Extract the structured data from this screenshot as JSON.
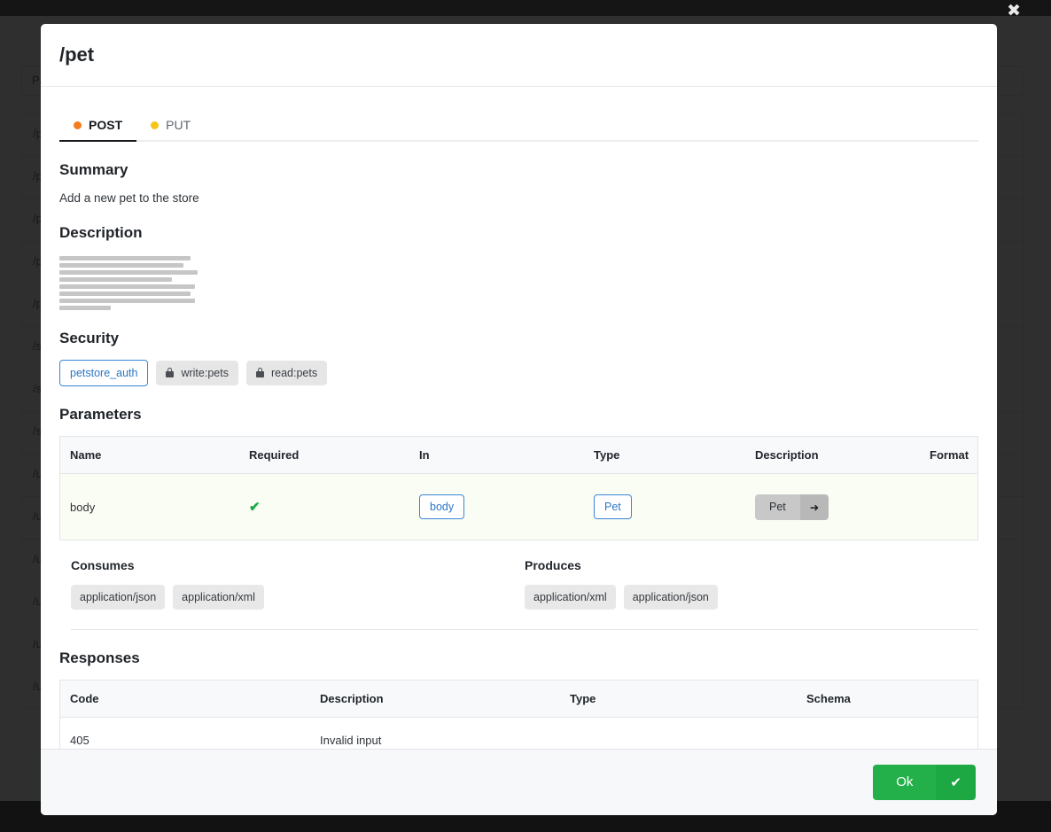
{
  "background": {
    "search_value": "Pa",
    "rows": [
      {
        "label": "/pet"
      },
      {
        "label": "/pet/findByStatus"
      },
      {
        "label": "/pet/findByTags"
      },
      {
        "label": "/pet/{petId}"
      },
      {
        "label": "/pet/{petId}/uploadImage"
      },
      {
        "label": "/store/inventory"
      },
      {
        "label": "/store/order"
      },
      {
        "label": "/store/order/{orderId}"
      },
      {
        "label": "/user"
      },
      {
        "label": "/user/createWithArray"
      },
      {
        "label": "/user/createWithList"
      },
      {
        "label": "/user/login"
      },
      {
        "label": "/user/logout"
      },
      {
        "label": "/user/{username}"
      }
    ]
  },
  "overlay": {
    "close_icon": "✖"
  },
  "modal": {
    "title": "/pet",
    "tabs": [
      {
        "label": "POST",
        "dot_color": "#f57c1f",
        "active": true
      },
      {
        "label": "PUT",
        "dot_color": "#f5c518",
        "active": false
      }
    ],
    "summary": {
      "heading": "Summary",
      "text": "Add a new pet to the store"
    },
    "description": {
      "heading": "Description",
      "skeleton_widths": [
        148,
        140,
        156,
        127,
        153,
        148,
        153,
        58
      ]
    },
    "security": {
      "heading": "Security",
      "auth_label": "petstore_auth",
      "scopes": [
        {
          "label": "write:pets",
          "icon": "lock-icon"
        },
        {
          "label": "read:pets",
          "icon": "lock-icon"
        }
      ]
    },
    "parameters": {
      "heading": "Parameters",
      "columns": [
        "Name",
        "Required",
        "In",
        "Type",
        "Description",
        "Format"
      ],
      "rows": [
        {
          "name": "body",
          "required": "✔",
          "in": "body",
          "type": "Pet",
          "description_label": "Pet",
          "description_arrow": "➜",
          "format": ""
        }
      ]
    },
    "consumes": {
      "title": "Consumes",
      "items": [
        "application/json",
        "application/xml"
      ]
    },
    "produces": {
      "title": "Produces",
      "items": [
        "application/xml",
        "application/json"
      ]
    },
    "responses": {
      "heading": "Responses",
      "columns": [
        "Code",
        "Description",
        "Type",
        "Schema"
      ],
      "rows": [
        {
          "code": "405",
          "description": "Invalid input",
          "type": "",
          "schema": ""
        }
      ]
    },
    "footer": {
      "ok_label": "Ok",
      "ok_check": "✔"
    }
  }
}
